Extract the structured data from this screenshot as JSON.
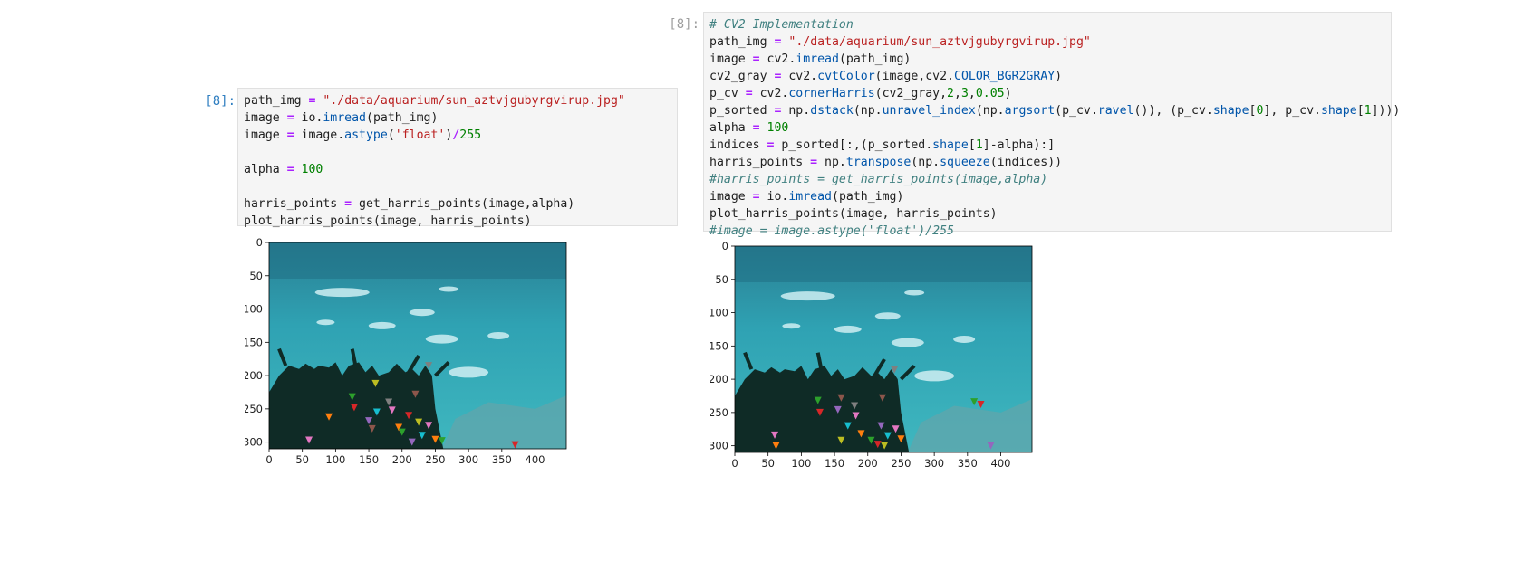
{
  "left_cell": {
    "prompt": "[8]:",
    "lines": [
      [
        [
          "path_img ",
          ""
        ],
        [
          "=",
          "kw-op"
        ],
        [
          " ",
          ""
        ],
        [
          "\"./data/aquarium/sun_aztvjgubyrgvirup.jpg\"",
          "str"
        ]
      ],
      [
        [
          "image ",
          ""
        ],
        [
          "=",
          "kw-op"
        ],
        [
          " io.",
          ""
        ],
        [
          "imread",
          "fn"
        ],
        [
          "(path_img)",
          ""
        ]
      ],
      [
        [
          "image ",
          ""
        ],
        [
          "=",
          "kw-op"
        ],
        [
          " image.",
          ""
        ],
        [
          "astype",
          "fn"
        ],
        [
          "(",
          ""
        ],
        [
          "'float'",
          "str"
        ],
        [
          ")",
          ""
        ],
        [
          "/",
          "kw-op"
        ],
        [
          "255",
          "num"
        ]
      ],
      [
        [
          "",
          ""
        ]
      ],
      [
        [
          "alpha ",
          ""
        ],
        [
          "=",
          "kw-op"
        ],
        [
          " ",
          ""
        ],
        [
          "100",
          "num"
        ]
      ],
      [
        [
          "",
          ""
        ]
      ],
      [
        [
          "harris_points ",
          ""
        ],
        [
          "=",
          "kw-op"
        ],
        [
          " get_harris_points(image,alpha)",
          ""
        ]
      ],
      [
        [
          "plot_harris_points(image, harris_points)",
          ""
        ]
      ]
    ],
    "plot": {
      "x_ticks": [
        "0",
        "50",
        "100",
        "150",
        "200",
        "250",
        "300",
        "350",
        "400"
      ],
      "y_ticks": [
        "0",
        "50",
        "100",
        "150",
        "200",
        "250",
        "300"
      ]
    }
  },
  "right_cell": {
    "prompt": "[8]:",
    "lines": [
      [
        [
          "# CV2 Implementation",
          "cmt"
        ]
      ],
      [
        [
          "path_img ",
          ""
        ],
        [
          "=",
          "kw-op"
        ],
        [
          " ",
          ""
        ],
        [
          "\"./data/aquarium/sun_aztvjgubyrgvirup.jpg\"",
          "str"
        ]
      ],
      [
        [
          "image ",
          ""
        ],
        [
          "=",
          "kw-op"
        ],
        [
          " cv2.",
          ""
        ],
        [
          "imread",
          "fn"
        ],
        [
          "(path_img)",
          ""
        ]
      ],
      [
        [
          "cv2_gray ",
          ""
        ],
        [
          "=",
          "kw-op"
        ],
        [
          " cv2.",
          ""
        ],
        [
          "cvtColor",
          "fn"
        ],
        [
          "(image,cv2.",
          ""
        ],
        [
          "COLOR_BGR2GRAY",
          "fn"
        ],
        [
          ")",
          ""
        ]
      ],
      [
        [
          "p_cv ",
          ""
        ],
        [
          "=",
          "kw-op"
        ],
        [
          " cv2.",
          ""
        ],
        [
          "cornerHarris",
          "fn"
        ],
        [
          "(cv2_gray,",
          ""
        ],
        [
          "2",
          "num"
        ],
        [
          ",",
          ""
        ],
        [
          "3",
          "num"
        ],
        [
          ",",
          ""
        ],
        [
          "0.05",
          "num"
        ],
        [
          ")",
          ""
        ]
      ],
      [
        [
          "p_sorted ",
          ""
        ],
        [
          "=",
          "kw-op"
        ],
        [
          " np.",
          ""
        ],
        [
          "dstack",
          "fn"
        ],
        [
          "(np.",
          ""
        ],
        [
          "unravel_index",
          "fn"
        ],
        [
          "(np.",
          ""
        ],
        [
          "argsort",
          "fn"
        ],
        [
          "(p_cv.",
          ""
        ],
        [
          "ravel",
          "fn"
        ],
        [
          "()), (p_cv.",
          ""
        ],
        [
          "shape",
          "fn"
        ],
        [
          "[",
          ""
        ],
        [
          "0",
          "num"
        ],
        [
          "], p_cv.",
          ""
        ],
        [
          "shape",
          "fn"
        ],
        [
          "[",
          ""
        ],
        [
          "1",
          "num"
        ],
        [
          "])))",
          ""
        ]
      ],
      [
        [
          "alpha ",
          ""
        ],
        [
          "=",
          "kw-op"
        ],
        [
          " ",
          ""
        ],
        [
          "100",
          "num"
        ]
      ],
      [
        [
          "indices ",
          ""
        ],
        [
          "=",
          "kw-op"
        ],
        [
          " p_sorted[:,(p_sorted.",
          ""
        ],
        [
          "shape",
          "fn"
        ],
        [
          "[",
          ""
        ],
        [
          "1",
          "num"
        ],
        [
          "]-alpha):]",
          ""
        ]
      ],
      [
        [
          "harris_points ",
          ""
        ],
        [
          "=",
          "kw-op"
        ],
        [
          " np.",
          ""
        ],
        [
          "transpose",
          "fn"
        ],
        [
          "(np.",
          ""
        ],
        [
          "squeeze",
          "fn"
        ],
        [
          "(indices))",
          ""
        ]
      ],
      [
        [
          "#harris_points = get_harris_points(image,alpha)",
          "cmt"
        ]
      ],
      [
        [
          "image ",
          ""
        ],
        [
          "=",
          "kw-op"
        ],
        [
          " io.",
          ""
        ],
        [
          "imread",
          "fn"
        ],
        [
          "(path_img)",
          ""
        ]
      ],
      [
        [
          "plot_harris_points(image, harris_points)",
          ""
        ]
      ],
      [
        [
          "#image = image.astype('float')/255",
          "cmt"
        ]
      ]
    ],
    "plot": {
      "x_ticks": [
        "0",
        "50",
        "100",
        "150",
        "200",
        "250",
        "300",
        "350",
        "400"
      ],
      "y_ticks": [
        "0",
        "50",
        "100",
        "150",
        "200",
        "250",
        "300"
      ]
    }
  },
  "colors": {
    "prompt_active": "#307fc1",
    "prompt_inactive": "#9e9e9e"
  },
  "icons": {
    "marker": "triangle-down-marker"
  }
}
